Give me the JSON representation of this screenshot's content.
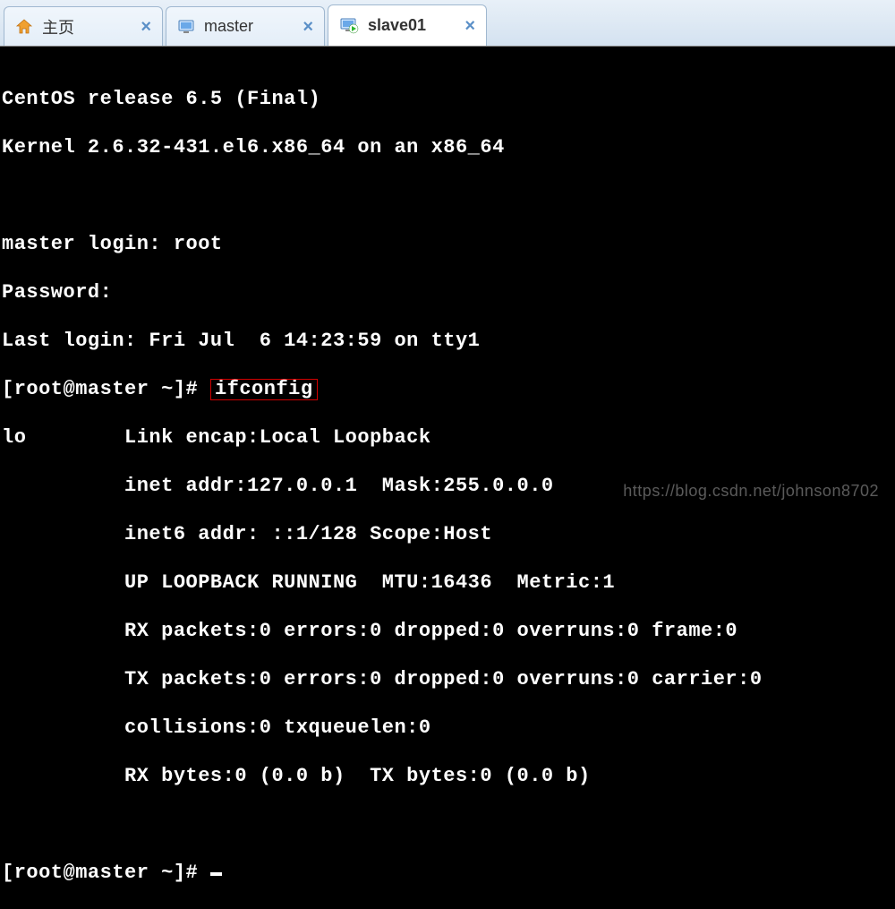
{
  "tabs": [
    {
      "label": "主页",
      "icon": "home",
      "active": false
    },
    {
      "label": "master",
      "icon": "monitor",
      "active": false
    },
    {
      "label": "slave01",
      "icon": "monitor-play",
      "active": true
    }
  ],
  "terminal": {
    "line1": "CentOS release 6.5 (Final)",
    "line2": "Kernel 2.6.32-431.el6.x86_64 on an x86_64",
    "line3": "master login: root",
    "line4": "Password:",
    "line5": "Last login: Fri Jul  6 14:23:59 on tty1",
    "prompt1_pre": "[root@master ~]# ",
    "command_hl": "ifconfig",
    "out1": "lo        Link encap:Local Loopback",
    "out2": "          inet addr:127.0.0.1  Mask:255.0.0.0",
    "out3": "          inet6 addr: ::1/128 Scope:Host",
    "out4": "          UP LOOPBACK RUNNING  MTU:16436  Metric:1",
    "out5": "          RX packets:0 errors:0 dropped:0 overruns:0 frame:0",
    "out6": "          TX packets:0 errors:0 dropped:0 overruns:0 carrier:0",
    "out7": "          collisions:0 txqueuelen:0",
    "out8": "          RX bytes:0 (0.0 b)  TX bytes:0 (0.0 b)",
    "prompt2": "[root@master ~]# "
  },
  "watermark": "https://blog.csdn.net/johnson8702"
}
